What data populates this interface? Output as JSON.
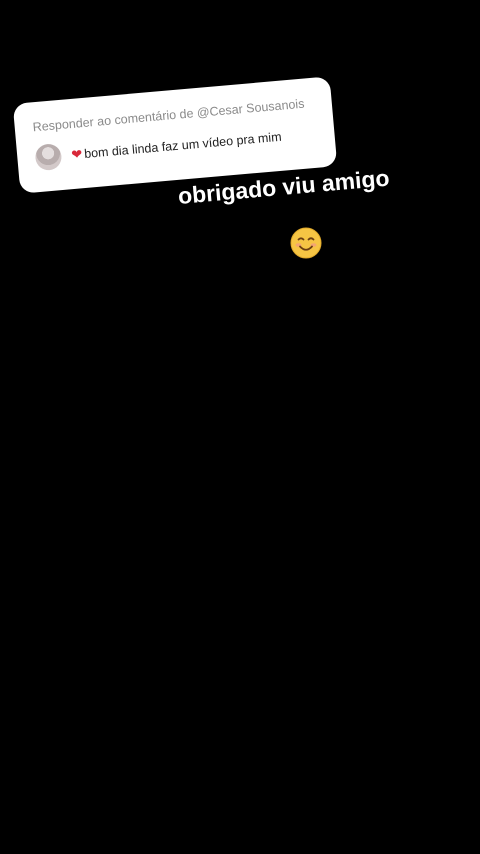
{
  "reply_card": {
    "header": "Responder ao comentário de @Cesar Sousanois",
    "heart_icon": "red-heart-icon",
    "comment_text": "bom dia linda faz um vídeo pra mim"
  },
  "reply_overlay": {
    "text": "obrigado viu amigo",
    "emoji_icon": "smiling-face-icon"
  },
  "colors": {
    "background": "#000000",
    "card": "#ffffff",
    "heart": "#d8283a",
    "emoji": "#f6c544"
  }
}
